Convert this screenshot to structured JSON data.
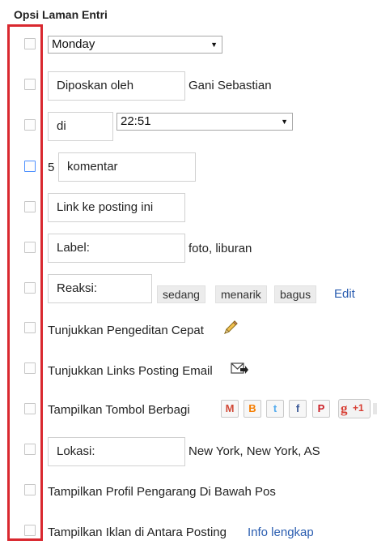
{
  "title": "Opsi Laman Entri",
  "rows": {
    "date": {
      "selected": "Monday"
    },
    "author": {
      "label": "Diposkan oleh",
      "value": "Gani Sebastian"
    },
    "time": {
      "label": "di",
      "selected": "22:51"
    },
    "comments": {
      "count": "5",
      "label": "komentar"
    },
    "permalink": {
      "label": "Link ke posting ini"
    },
    "labels": {
      "label": "Label:",
      "value": "foto, liburan"
    },
    "reactions": {
      "label": "Reaksi:",
      "options": [
        "sedang",
        "menarik",
        "bagus"
      ],
      "edit": "Edit"
    },
    "quick_edit": {
      "label": "Tunjukkan Pengeditan Cepat",
      "icon": "pencil-icon"
    },
    "email_links": {
      "label": "Tunjukkan Links Posting Email",
      "icon": "email-forward-icon"
    },
    "share_buttons": {
      "label": "Tampilkan Tombol Berbagi",
      "icons": [
        {
          "name": "gmail-share-icon",
          "glyph": "M",
          "color": "#d14836"
        },
        {
          "name": "blogger-share-icon",
          "glyph": "B",
          "color": "#f57d00"
        },
        {
          "name": "twitter-share-icon",
          "glyph": "t",
          "color": "#55acee"
        },
        {
          "name": "facebook-share-icon",
          "glyph": "f",
          "color": "#3b5998"
        },
        {
          "name": "pinterest-share-icon",
          "glyph": "P",
          "color": "#cb2027"
        }
      ],
      "gplus": "+1"
    },
    "location": {
      "label": "Lokasi:",
      "value": "New York, New York, AS"
    },
    "author_profile": {
      "label": "Tampilkan Profil Pengarang Di Bawah Pos"
    },
    "ads": {
      "label": "Tampilkan Iklan di Antara Posting",
      "link": "Info lengkap"
    }
  }
}
